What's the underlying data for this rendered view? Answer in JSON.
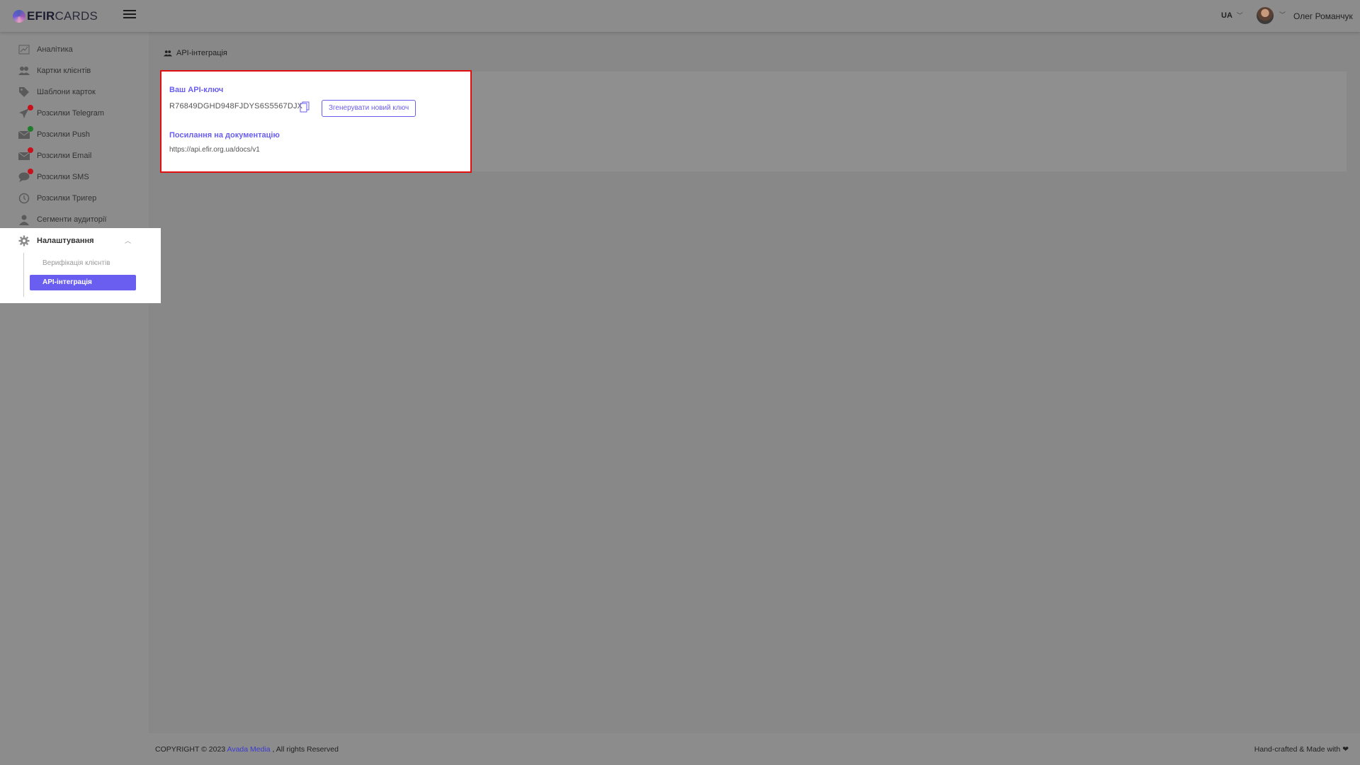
{
  "header": {
    "brand_bold": "EFIR",
    "brand_light": "CARDS",
    "language": "UA",
    "user_name": "Олег Романчук"
  },
  "sidebar": {
    "items": [
      {
        "label": "Аналітика",
        "icon": "chart-icon"
      },
      {
        "label": "Картки клієнтів",
        "icon": "users-icon"
      },
      {
        "label": "Шаблони карток",
        "icon": "tag-icon"
      },
      {
        "label": "Розсилки Telegram",
        "icon": "telegram-icon",
        "badge": "red"
      },
      {
        "label": "Розсилки Push",
        "icon": "envelope-icon",
        "badge": "green"
      },
      {
        "label": "Розсилки Email",
        "icon": "envelope-icon",
        "badge": "red"
      },
      {
        "label": "Розсилки SMS",
        "icon": "chat-icon",
        "badge": "red"
      },
      {
        "label": "Розсилки Тригер",
        "icon": "clock-icon"
      },
      {
        "label": "Сегменти аудиторії",
        "icon": "user-icon"
      }
    ],
    "settings": {
      "label": "Налаштування",
      "sub_items": [
        "Верифікація клієнтів"
      ],
      "active_sub_item": "API-інтеграція"
    }
  },
  "main": {
    "breadcrumb": "API-інтеграція",
    "api_key_label": "Ваш API-ключ",
    "api_key_value": "R76849DGHD948FJDYS6S5567DJX",
    "regenerate_button": "Згенерувати новий ключ",
    "docs_label": "Посилання на документацію",
    "docs_url": "https://api.efir.org.ua/docs/v1"
  },
  "footer": {
    "copyright_prefix": "COPYRIGHT © 2023",
    "company": "Avada Media",
    "copyright_suffix": ", All rights Reserved",
    "made_with": "Hand-crafted & Made with"
  },
  "colors": {
    "accent": "#6a5ef0",
    "highlight_border": "#e01010",
    "badge_red": "#c8101a",
    "badge_green": "#1e7c2a"
  }
}
